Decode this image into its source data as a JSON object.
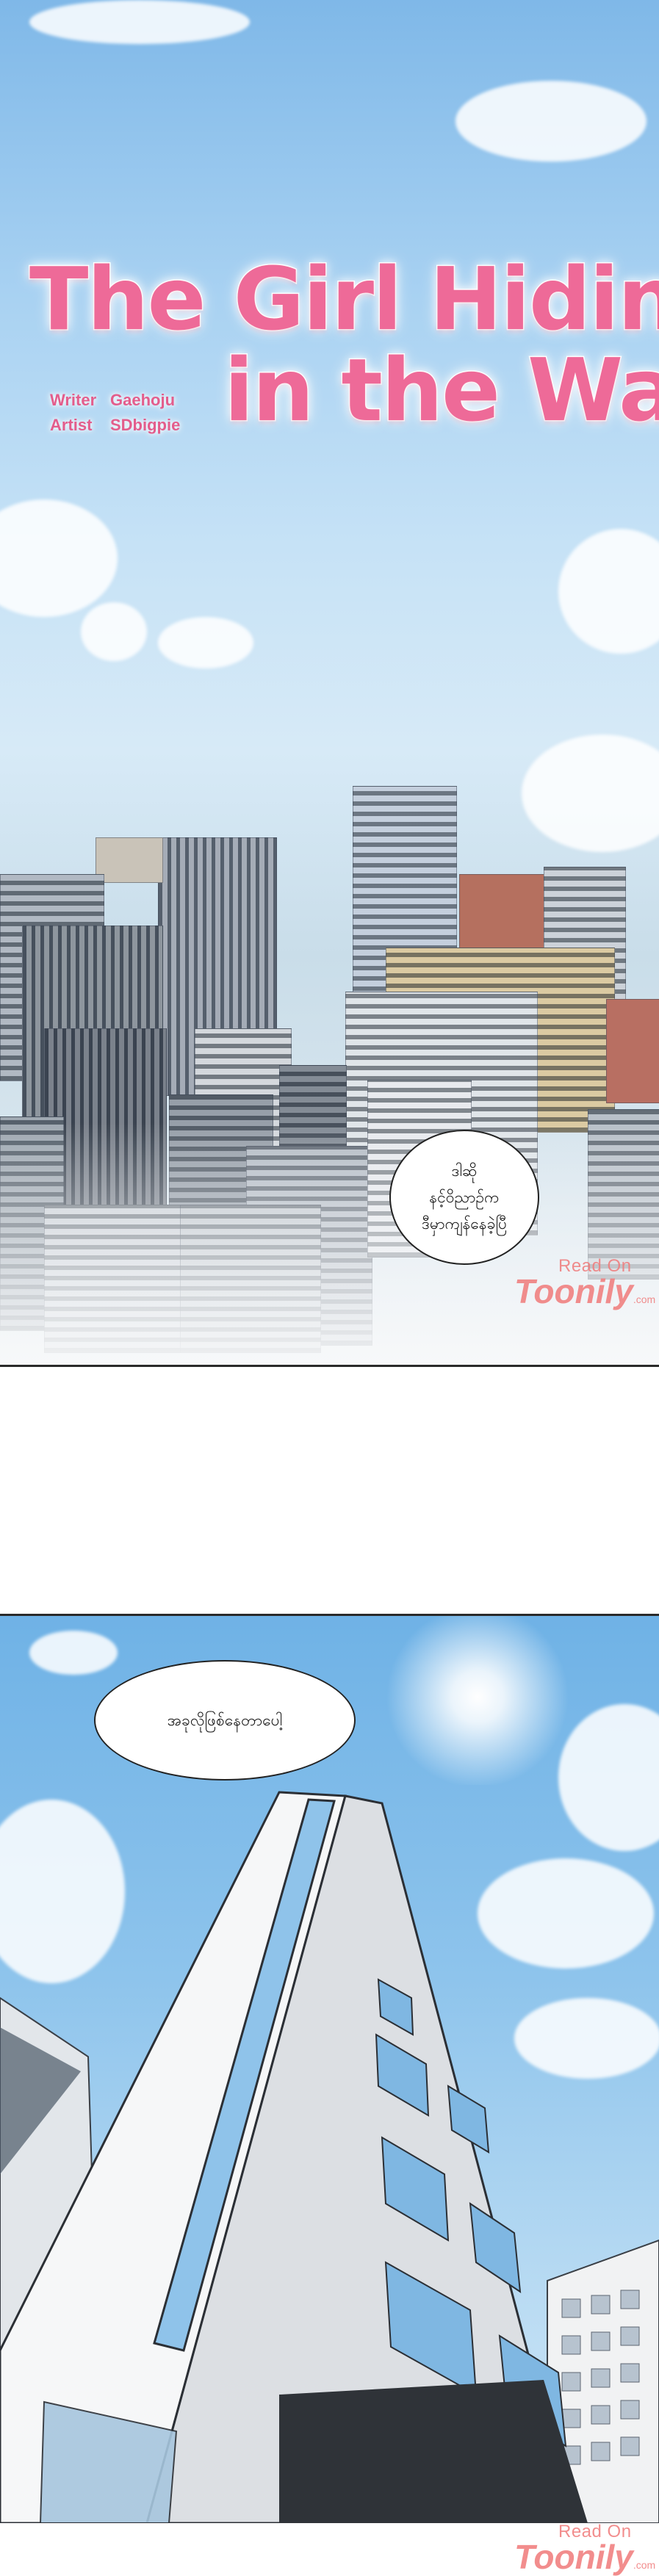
{
  "title": {
    "line1": "The Girl Hiding",
    "line2": "in the Wall"
  },
  "credits": {
    "writer_label": "Writer",
    "writer_name": "Gaehoju",
    "artist_label": "Artist",
    "artist_name": "SDbigpie"
  },
  "dialogue": {
    "bubble_1": "ဒါဆို\nနင့်ဝိညာဉ်က\nဒီမှာကျန်နေခဲ့ပြီ",
    "bubble_2": "အခုလိုဖြစ်နေတာပေါ့"
  },
  "watermark": {
    "top": "Read On",
    "brand": "Toonily",
    "suffix": ".com"
  },
  "colors": {
    "title_pink": "#ee6a98",
    "credits_pink": "#e35d8c",
    "watermark": "#f07a7a",
    "sky_top": "#7fb8e8"
  }
}
